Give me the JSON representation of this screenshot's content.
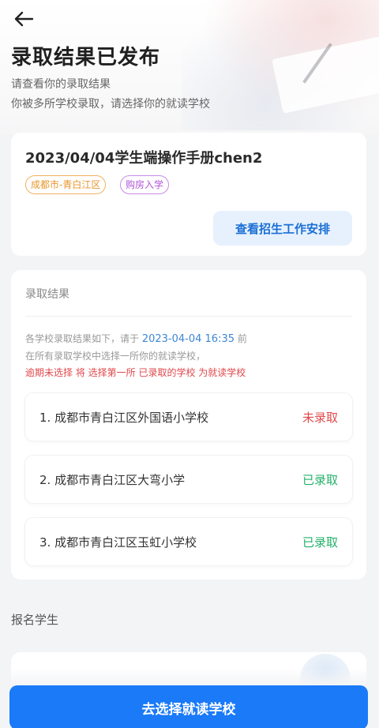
{
  "header": {
    "title": "录取结果已发布",
    "subtitle_line1": "请查看你的录取结果",
    "subtitle_line2": "你被多所学校录取，请选择你的就读学校"
  },
  "info_card": {
    "name": "2023/04/04学生端操作手册chen2",
    "tags": [
      "成都市-青白江区",
      "购房入学"
    ],
    "schedule_button": "查看招生工作安排"
  },
  "result_card": {
    "section_title": "录取结果",
    "note_prefix": "各学校录取结果如下，请于",
    "deadline": "2023-04-04 16:35",
    "note_suffix": "前",
    "note_line2": "在所有录取学校中选择一所你的就读学校，",
    "note_warning": "逾期未选择 将 选择第一所 已录取的学校 为就读学校",
    "schools": [
      {
        "name": "1. 成都市青白江区外国语小学校",
        "status": "未录取"
      },
      {
        "name": "2. 成都市青白江区大弯小学",
        "status": "已录取"
      },
      {
        "name": "3. 成都市青白江区玉虹小学校",
        "status": "已录取"
      }
    ]
  },
  "student_section": {
    "title": "报名学生"
  },
  "footer": {
    "button": "去选择就读学校"
  },
  "colors": {
    "primary": "#1a7af8",
    "not_admitted": "#e0484b",
    "admitted": "#23b06a",
    "deadline": "#3d86d6"
  }
}
